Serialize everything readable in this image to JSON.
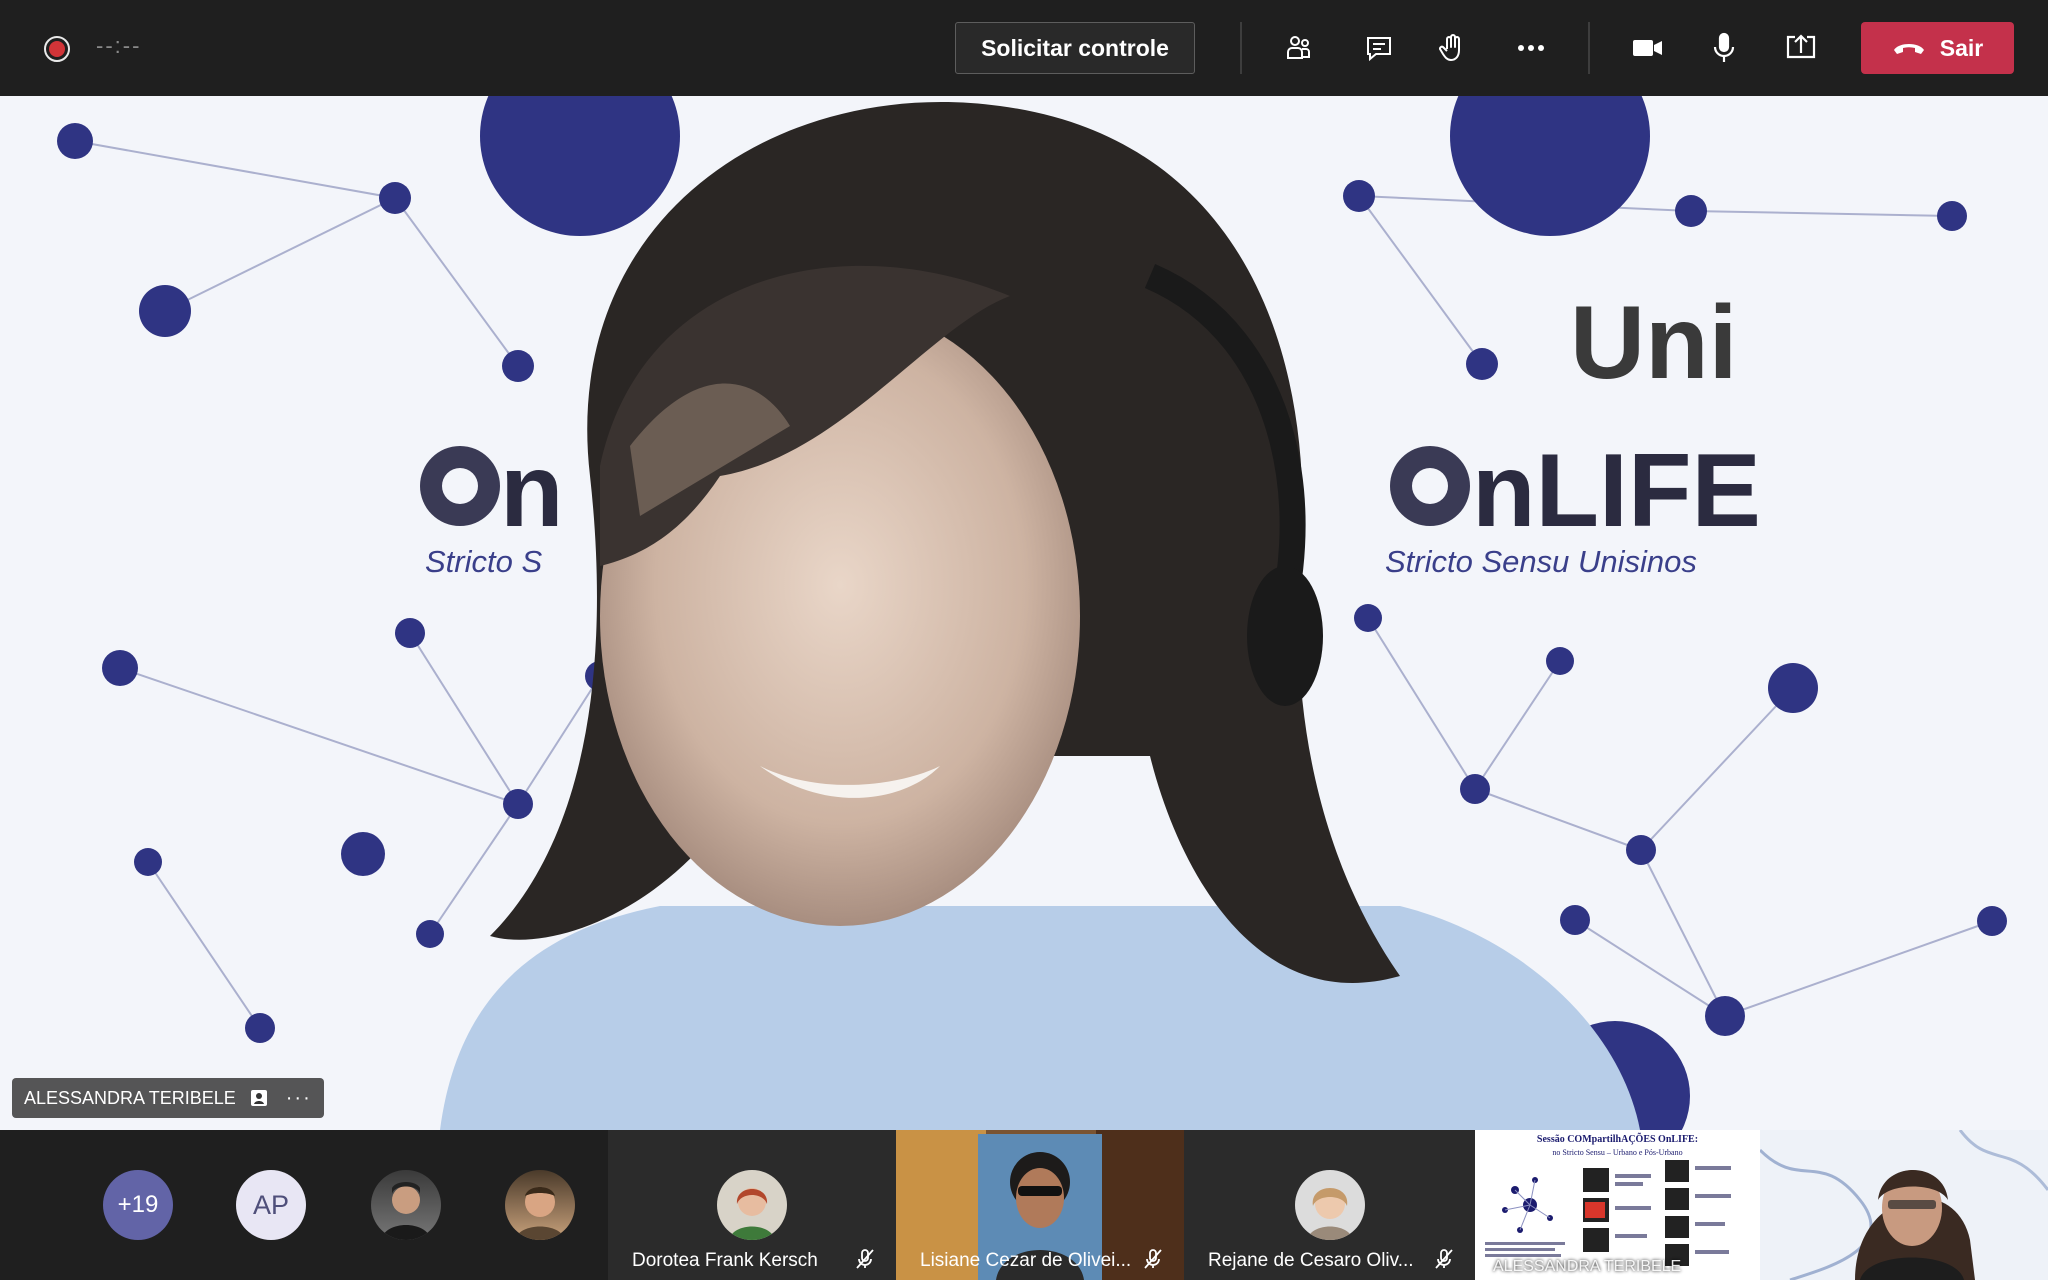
{
  "meeting": {
    "timer": "--:--",
    "request_control_label": "Solicitar controle",
    "leave_label": "Sair",
    "toolbar_icons": [
      "participants-icon",
      "chat-icon",
      "raise-hand-icon",
      "more-options-icon",
      "camera-icon",
      "microphone-icon",
      "share-screen-icon"
    ]
  },
  "stage": {
    "speaker_name": "ALESSANDRA TERIBELE",
    "backdrop_logo": {
      "line1": "Uni",
      "line2": "OnLIFE",
      "tagline": "Stricto Sensu Unisinos"
    }
  },
  "gallery": {
    "overflow_count": "+19",
    "initials": "AP",
    "tiles": [
      {
        "name": "Dorotea Frank Kersch"
      },
      {
        "name": "Lisiane Cezar de Olivei..."
      },
      {
        "name": "Rejane de Cesaro Oliv..."
      }
    ],
    "slide_tile": {
      "title": "Sessão COMpartilhAÇÕES OnLIFE:",
      "subtitle": "no Stricto Sensu – Urbano e Pós-Urbano",
      "overlay_name": "ALESSANDRA TERIBELE"
    }
  },
  "colors": {
    "accent": "#6264a7",
    "leave": "#c4314b",
    "recording": "#d13438",
    "network_node": "#2f3483"
  }
}
